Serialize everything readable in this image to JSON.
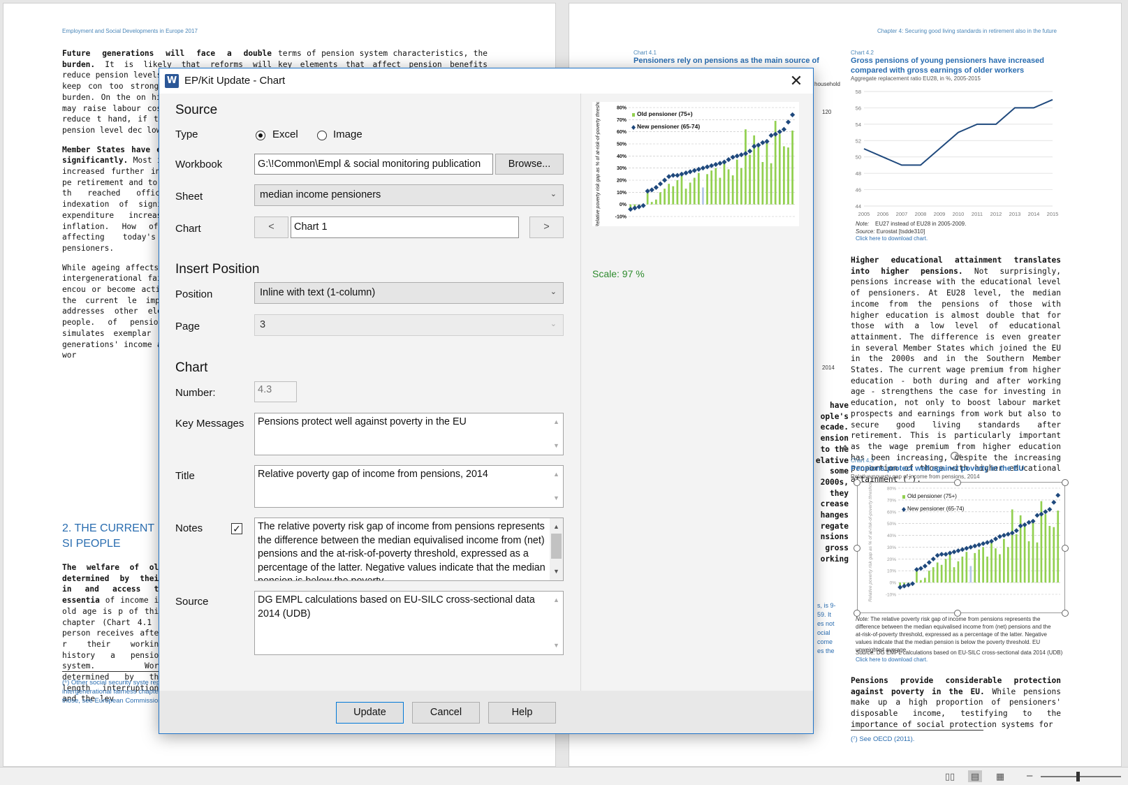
{
  "doc": {
    "left_header": "Employment and Social Developments in Europe 2017",
    "right_header": "Chapter 4: Securing good living standards in retirement also in the future",
    "left_col1_p1_bold": "Future generations will face a double burden.",
    "left_col1_p1": " It is likely that reforms will reduce pension levels in the future so as to keep con too strongly. As a result double burden. On the on higher contribution rates may raise labour costs ar labour market or reduce t hand, if their labour mar general pension level dec lower pension after retire",
    "left_col1_p2_bold": "Member States have e that are projected to significantly.",
    "left_col1_p2": " Most im have been raised almo increased further in the been to introduce pe retirement and to pay postpones taking up th reached official retireme annual indexation of significantly and will be expenditure increases tha growth and inflation. How of these reforms will affecting today's young p today's pensioners.",
    "left_col1_p3": "While ageing affects all chapter focuses on intergenerational fairnes expenditure and/or encou or become active in the la a look at the current le important source of olde addresses other elemen welfare of older people. of pension expenditure ar it simulates exemplar countries to show how generations' income and both young and older wor",
    "left_col2_p1": "terms of pension system characteristics, the key elements that affect pension benefits relate to the",
    "left_heading": "2. THE CURRENT SI PEOPLE",
    "left_col1_p4_bold": "The welfare of old determined by their in and access to essentia",
    "left_col1_p4": " of income in old age is p of this chapter (Chart 4.1 a person receives after r their working history a pension system. Work determined by the length interruptions and the lev",
    "left_footnote": "(⁶) Other social security syste represent an important cha intergenerational fairness chapter. For further readin those, see European Commission (2015b).",
    "right_c41_label": "Chart 4.1",
    "right_c41_title": "Pensioners rely on pensions as the main source of",
    "right_c41_household": "household",
    "right_c41_120": "120",
    "right_c41_2014": "2014",
    "right_frag": "have ople's ecade. ension to the elative some 2000s, they crease hanges regate nsions gross orking",
    "right_frag2": "s, is 9-59. It es not ocial come es the",
    "right_c42_label": "Chart 4.2",
    "right_c42_title": "Gross pensions of young pensioners have increased compared with gross earnings of older workers",
    "right_c42_sub": "Aggregate replacement ratio EU28, in %, 2005-2015",
    "right_c42_note_k": "Note:",
    "right_c42_note": "EU27 instead of EU28 in 2005-2009.",
    "right_c42_src_k": "Source:",
    "right_c42_src": "Eurostat [tsdde310]",
    "right_c42_link": "Click here to download chart.",
    "right_p1_bold": "Higher educational attainment translates into higher pensions.",
    "right_p1": " Not surprisingly, pensions increase with the educational level of pensioners. At EU28 level, the median income from the pensions of those with higher education is almost double that for those with a low level of educational attainment. The difference is even greater in several Member States which joined the EU in the 2000s and in the Southern Member States. The current wage premium from higher education - both during and after working age - strengthens the case for investing in education, not only to boost labour market prospects and earnings from work but also to secure good living standards after retirement. This is particularly important as the wage premium from higher education has been increasing, despite the increasing proportion of those with higher educational attainment (⁷).",
    "right_c43_label": "Chart 4.3",
    "right_c43_title": "Pensions protect well against poverty in the EU",
    "right_c43_sub": "Relative poverty gap of income from pensions, 2014",
    "right_c43_note_k": "Note:",
    "right_c43_note": "The relative poverty risk gap of income from pensions represents the difference between the median equivalised income from (net) pensions and the at-risk-of-poverty threshold, expressed as a percentage of the latter. Negative values indicate that the median pension is below the poverty threshold. EU unweighted average.",
    "right_c43_src_k": "Source:",
    "right_c43_src": "DG EMPL calculations based on EU-SILC cross-sectional data 2014 (UDB)",
    "right_c43_link": "Click here to download chart.",
    "right_p2_bold": "Pensions provide considerable protection against poverty in the EU.",
    "right_p2": " While pensions make up a high proportion of pensioners' disposable income, testifying to the importance of social protection systems for",
    "right_footnote": "(⁷) See OECD (2011)."
  },
  "dialog": {
    "title": "EP/Kit Update - Chart",
    "app_icon": "W",
    "close_glyph": "✕",
    "source_heading": "Source",
    "type_label": "Type",
    "type_options": [
      "Excel",
      "Image"
    ],
    "type_selected": "Excel",
    "workbook_label": "Workbook",
    "workbook_value": "G:\\!Common\\Empl & social monitoring publication",
    "browse_label": "Browse...",
    "sheet_label": "Sheet",
    "sheet_value": "median income pensioners",
    "chart_label": "Chart",
    "chart_prev": "<",
    "chart_next": ">",
    "chart_value": "Chart 1",
    "insert_heading": "Insert Position",
    "position_label": "Position",
    "position_value": "Inline with text (1-column)",
    "page_label": "Page",
    "page_value": "3",
    "chart_heading": "Chart",
    "number_label": "Number:",
    "number_value": "4.3",
    "key_messages_label": "Key Messages",
    "key_messages_value": "Pensions protect well against poverty in the EU",
    "title_label": "Title",
    "title_value": "Relative poverty gap of income from pensions, 2014",
    "notes_label": "Notes",
    "notes_checked": "✓",
    "notes_value": "The relative poverty risk gap of income from pensions represents the difference between the median equivalised income from (net) pensions and the at-risk-of-poverty threshold, expressed as a percentage of the latter. Negative values indicate that the median pension is below the poverty",
    "source_label": "Source",
    "source_value": "DG EMPL calculations based on EU-SILC cross-sectional data 2014 (UDB)",
    "scale_text": "Scale: 97 %",
    "update_label": "Update",
    "cancel_label": "Cancel",
    "help_label": "Help"
  },
  "chart_data": [
    {
      "type": "bar",
      "ylabel": "Relative poverty risk gap as % of at-risk-of-poverty threshold",
      "ylim": [
        -10,
        80
      ],
      "yticks": [
        "80%",
        "70%",
        "60%",
        "50%",
        "40%",
        "30%",
        "20%",
        "10%",
        "0%",
        "-10%"
      ],
      "series": [
        {
          "name": "Old pensioner (75+)",
          "color": "#92d050",
          "kind": "bar",
          "values": [
            -3,
            -2,
            -1,
            0,
            11,
            2,
            4,
            10,
            13,
            17,
            15,
            20,
            24,
            13,
            18,
            22,
            26,
            14,
            25,
            28,
            30,
            22,
            35,
            29,
            24,
            37,
            30,
            62,
            41,
            57,
            48,
            35,
            53,
            34,
            69,
            58,
            48,
            47,
            61
          ]
        },
        {
          "name": "New pensioner (65-74)",
          "color": "#1f497d",
          "kind": "point",
          "values": [
            -4,
            -3,
            -2,
            -1,
            11,
            12,
            14,
            17,
            20,
            23,
            24,
            24,
            25,
            26,
            27,
            28,
            29,
            30,
            31,
            32,
            33,
            34,
            35,
            37,
            39,
            40,
            41,
            42,
            44,
            48,
            49,
            51,
            52,
            57,
            58,
            60,
            62,
            68,
            74
          ]
        }
      ]
    },
    {
      "type": "line",
      "title": "Gross pensions of young pensioners have increased compared with gross earnings of older workers",
      "x": [
        "2005",
        "2006",
        "2007",
        "2008",
        "2009",
        "2010",
        "2011",
        "2012",
        "2013",
        "2014",
        "2015"
      ],
      "values": [
        51,
        50,
        49,
        49,
        51,
        53,
        54,
        54,
        56,
        56,
        57
      ],
      "yticks": [
        "58",
        "56",
        "54",
        "52",
        "50",
        "48",
        "46",
        "44"
      ],
      "ylim": [
        44,
        58
      ],
      "color": "#1f497d"
    }
  ],
  "statusbar": {
    "view_read": "▯▯",
    "view_print": "▤",
    "view_web": "▦",
    "zoom_minus": "–"
  }
}
